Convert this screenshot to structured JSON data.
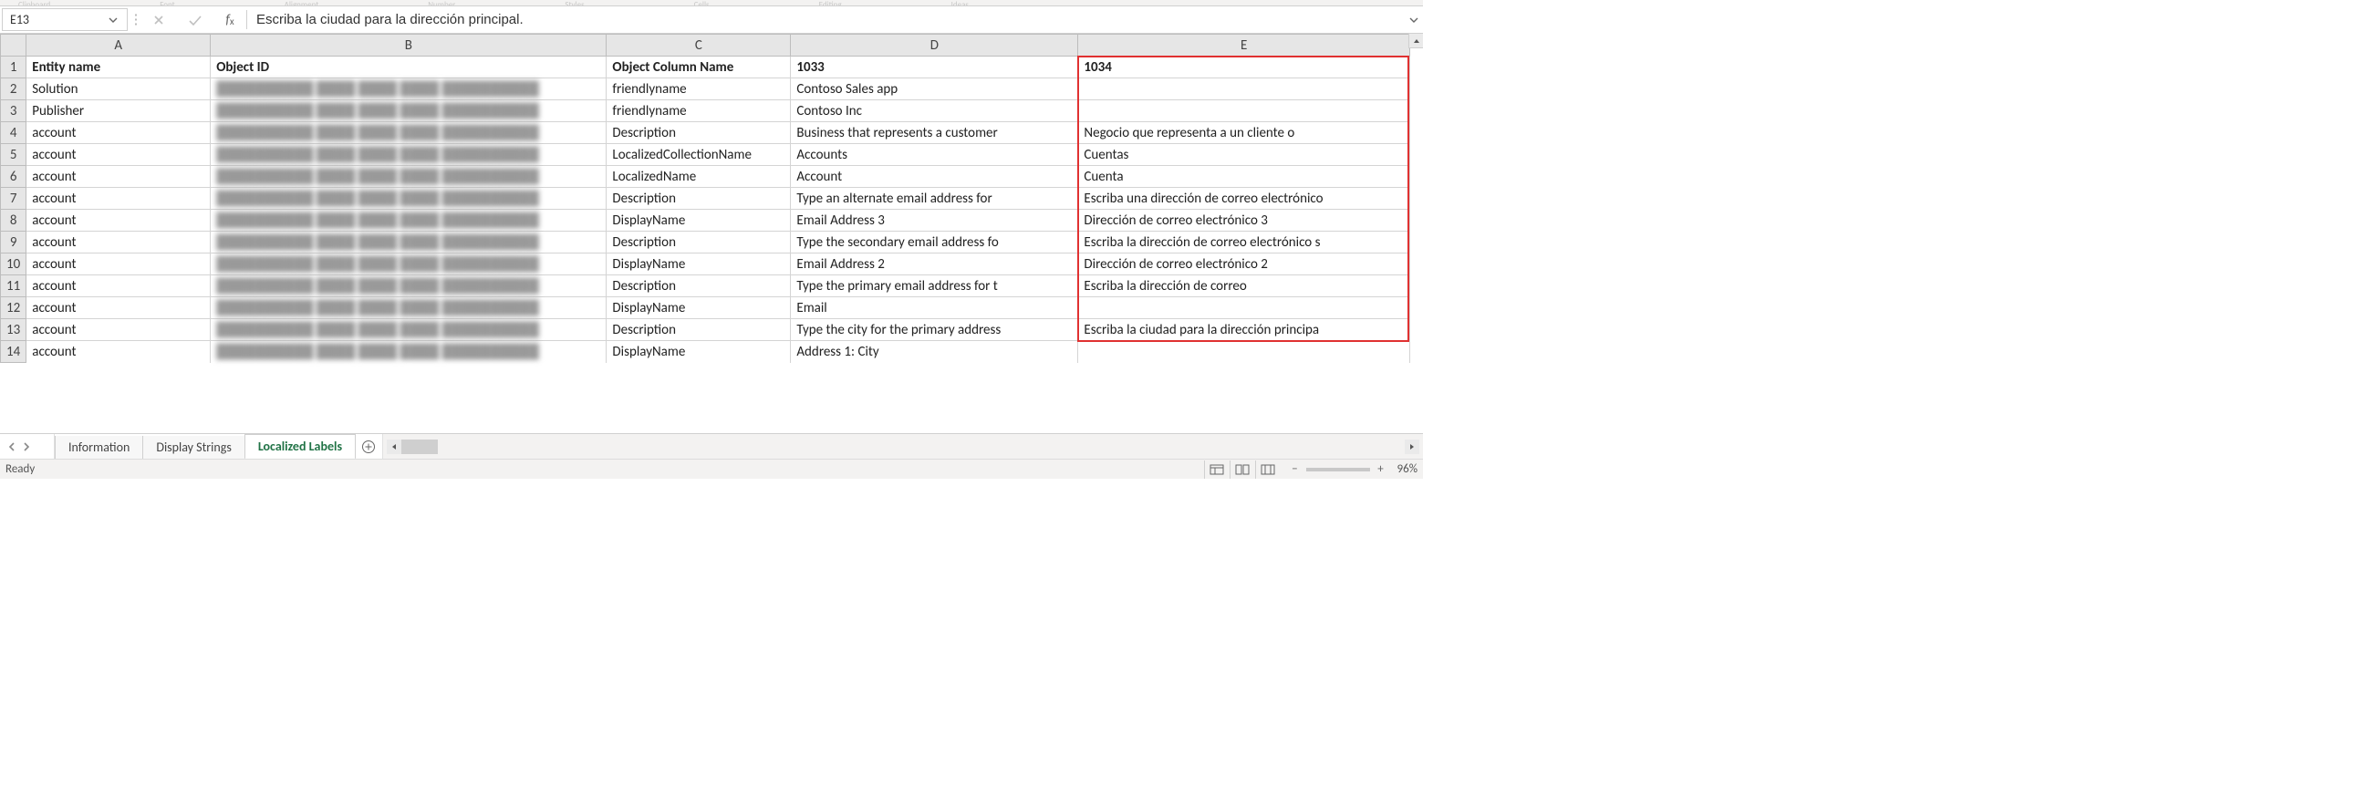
{
  "nameBox": {
    "ref": "E13"
  },
  "formulaBar": {
    "value": "Escriba la ciudad para la dirección principal."
  },
  "ribbonGroups": [
    "Clipboard",
    "Font",
    "Alignment",
    "Number",
    "Styles",
    "Cells",
    "Editing",
    "Ideas"
  ],
  "colHeaders": {
    "a": "A",
    "b": "B",
    "c": "C",
    "d": "D",
    "e": "E"
  },
  "rows": [
    {
      "n": "1",
      "a": "Entity name",
      "b": "Object ID",
      "c": "Object Column Name",
      "d": "1033",
      "e": "1034"
    },
    {
      "n": "2",
      "a": "Solution",
      "b": "",
      "c": "friendlyname",
      "d": "Contoso Sales app",
      "e": ""
    },
    {
      "n": "3",
      "a": "Publisher",
      "b": "",
      "c": "friendlyname",
      "d": "Contoso Inc",
      "e": ""
    },
    {
      "n": "4",
      "a": "account",
      "b": "",
      "c": "Description",
      "d": "Business that represents a customer",
      "e": "Negocio que representa a un cliente o"
    },
    {
      "n": "5",
      "a": "account",
      "b": "",
      "c": "LocalizedCollectionName",
      "d": "Accounts",
      "e": "Cuentas"
    },
    {
      "n": "6",
      "a": "account",
      "b": "",
      "c": "LocalizedName",
      "d": "Account",
      "e": "Cuenta"
    },
    {
      "n": "7",
      "a": "account",
      "b": "",
      "c": "Description",
      "d": "Type an alternate email address for",
      "e": "Escriba una dirección de correo electrónico"
    },
    {
      "n": "8",
      "a": "account",
      "b": "",
      "c": "DisplayName",
      "d": "Email Address 3",
      "e": "Dirección de correo electrónico 3"
    },
    {
      "n": "9",
      "a": "account",
      "b": "",
      "c": "Description",
      "d": "Type the secondary email address fo",
      "e": "Escriba la dirección de correo electrónico s"
    },
    {
      "n": "10",
      "a": "account",
      "b": "",
      "c": "DisplayName",
      "d": "Email Address 2",
      "e": "Dirección de correo electrónico 2"
    },
    {
      "n": "11",
      "a": "account",
      "b": "",
      "c": "Description",
      "d": "Type the primary email address for t",
      "e": "Escriba la dirección de correo"
    },
    {
      "n": "12",
      "a": "account",
      "b": "",
      "c": "DisplayName",
      "d": "Email",
      "e": ""
    },
    {
      "n": "13",
      "a": "account",
      "b": "",
      "c": "Description",
      "d": "Type the city for the primary address",
      "e": "Escriba la ciudad para la dirección principa"
    },
    {
      "n": "14",
      "a": "account",
      "b": "",
      "c": "DisplayName",
      "d": "Address 1: City",
      "e": ""
    }
  ],
  "sheets": {
    "information": "Information",
    "displayStrings": "Display Strings",
    "localizedLabels": "Localized Labels"
  },
  "status": {
    "ready": "Ready",
    "zoom": "96%"
  },
  "colWidths": {
    "a": 200,
    "b": 430,
    "c": 200,
    "d": 312,
    "e": 360
  }
}
